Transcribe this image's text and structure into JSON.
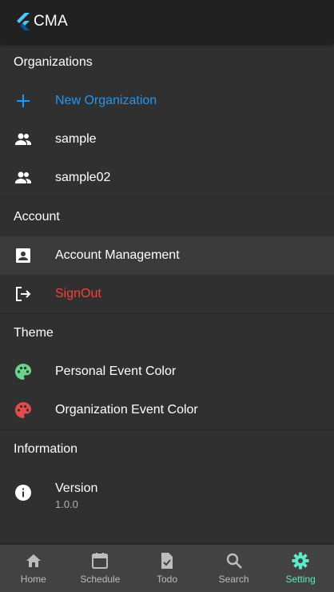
{
  "app": {
    "title": "CMA"
  },
  "sections": {
    "organizations": {
      "header": "Organizations",
      "items": [
        {
          "label": "New Organization",
          "icon": "add-icon"
        },
        {
          "label": "sample",
          "icon": "people-icon"
        },
        {
          "label": "sample02",
          "icon": "people-icon"
        }
      ]
    },
    "account": {
      "header": "Account",
      "items": [
        {
          "label": "Account Management",
          "icon": "account-box-icon"
        },
        {
          "label": "SignOut",
          "icon": "logout-icon"
        }
      ]
    },
    "theme": {
      "header": "Theme",
      "items": [
        {
          "label": "Personal Event Color",
          "icon": "palette-icon",
          "color": "#69d38a"
        },
        {
          "label": "Organization Event Color",
          "icon": "palette-icon",
          "color": "#e44b4b"
        }
      ]
    },
    "information": {
      "header": "Information",
      "items": [
        {
          "label": "Version",
          "value": "1.0.0",
          "icon": "info-icon"
        }
      ]
    }
  },
  "bottom_nav": [
    {
      "label": "Home",
      "icon": "home-icon"
    },
    {
      "label": "Schedule",
      "icon": "calendar-icon"
    },
    {
      "label": "Todo",
      "icon": "todo-icon"
    },
    {
      "label": "Search",
      "icon": "search-icon"
    },
    {
      "label": "Setting",
      "icon": "gear-icon",
      "selected": true
    }
  ],
  "colors": {
    "accent_blue": "#2196f3",
    "signout_red": "#f44336",
    "selected_nav": "#5ee9c4",
    "background": "#303030",
    "appbar": "#212121"
  }
}
